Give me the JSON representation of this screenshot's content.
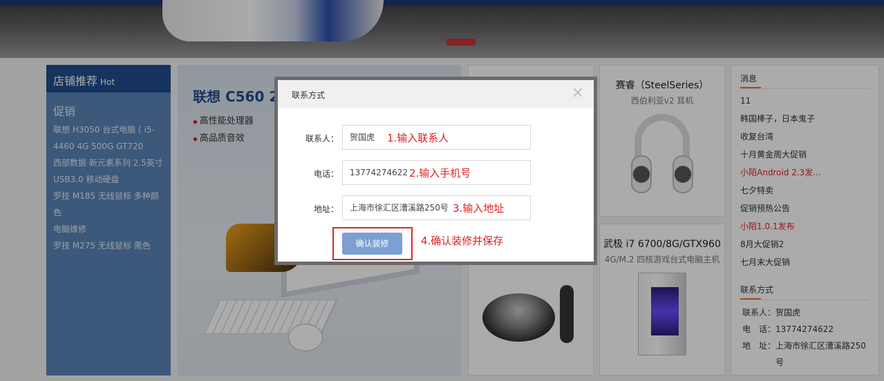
{
  "shop": {
    "title": "店铺推荐",
    "hot": "Hot",
    "promo_title": "促销",
    "promo_items": [
      "联想 H3050 台式电脑 ( i5-",
      "4460 4G 500G GT720",
      "西部数据 新元素系列 2.5英寸",
      "USB3.0 移动硬盘",
      "罗技 M185 无线鼠标 多种颜色",
      "电脑维修",
      "罗技 M275 无线鼠标 黑色"
    ]
  },
  "feature": {
    "title": "联想 C560 2",
    "bullets": [
      "高性能处理器",
      "高品质音效"
    ]
  },
  "cards": {
    "steelseries_title": "赛睿（SteelSeries）",
    "steelseries_sub": "西伯利亚v2 耳机",
    "pc_title": "武极 i7 6700/8G/GTX960",
    "pc_sub": "4G/M.2 四核游戏台式电脑主机"
  },
  "sidebar": {
    "news_title": "消息",
    "news_items": [
      {
        "text": "11",
        "red": false
      },
      {
        "text": "韩国棒子，日本鬼子",
        "red": false
      },
      {
        "text": "收复台湾",
        "red": false
      },
      {
        "text": "十月黄金周大促销",
        "red": false
      },
      {
        "text": "小陌Android 2.3发...",
        "red": true
      },
      {
        "text": "七夕特卖",
        "red": false
      },
      {
        "text": "促销预热公告",
        "red": false
      },
      {
        "text": "小陌1.0.1发布",
        "red": true
      },
      {
        "text": "8月大促销2",
        "red": false
      },
      {
        "text": "七月末大促销",
        "red": false
      }
    ],
    "contact_title": "联系方式",
    "contact_person": "联系人：贺国虎",
    "contact_phone": "电　话：13774274622",
    "contact_address_1": "地　址：上海市徐汇区漕溪路250",
    "contact_address_2": "号"
  },
  "modal": {
    "title": "联系方式",
    "close": "×",
    "fields": {
      "contact_label": "联系人：",
      "contact_value": "贺国虎",
      "phone_label": "电话：",
      "phone_value": "13774274622",
      "address_label": "地址：",
      "address_value": "上海市徐汇区漕溪路250号"
    },
    "annotations": {
      "step1": "1.输入联系人",
      "step2": "2.输入手机号",
      "step3": "3.输入地址",
      "step4": "4.确认装修并保存"
    },
    "save_label": "确认装修"
  },
  "colors": {
    "accent_blue": "#1f4c8d",
    "panel_blue": "#5a83b8",
    "button_blue": "#7d9fd2",
    "annotation_red": "#d22",
    "highlight_box_red": "#d62a2a"
  }
}
